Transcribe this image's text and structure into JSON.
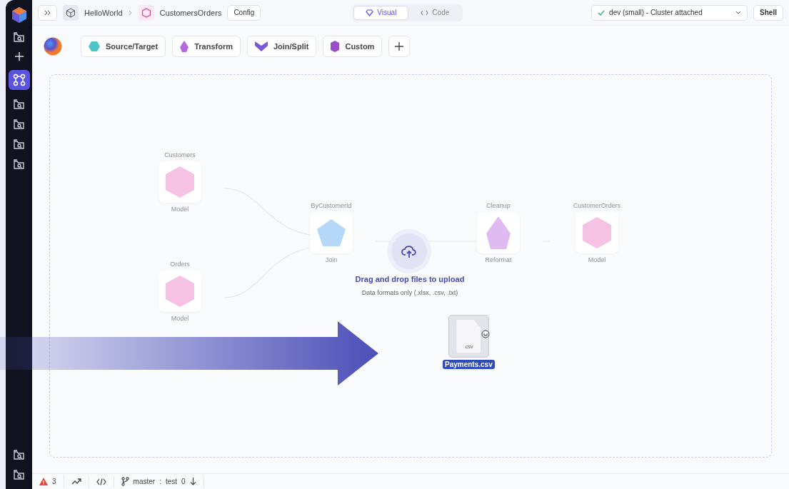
{
  "top_bar": {
    "breadcrumb": [
      {
        "label": "HelloWorld",
        "kind": "project"
      },
      {
        "label": "CustomersOrders",
        "kind": "pipeline"
      }
    ],
    "config_button": "Config",
    "view_tabs": [
      {
        "label": "Visual",
        "kind": "visual",
        "selected": true
      },
      {
        "label": "Code",
        "kind": "code",
        "selected": false
      }
    ],
    "cluster": {
      "label": "dev (small) - Cluster attached",
      "attached": true
    },
    "shell_button": "Shell"
  },
  "palette": [
    {
      "label": "Source/Target",
      "kind": "source"
    },
    {
      "label": "Transform",
      "kind": "transform"
    },
    {
      "label": "Join/Split",
      "kind": "join"
    },
    {
      "label": "Custom",
      "kind": "custom"
    }
  ],
  "canvas": {
    "nodes": [
      {
        "title": "Customers",
        "subtitle": "Model",
        "kind": "model"
      },
      {
        "title": "Orders",
        "subtitle": "Model",
        "kind": "model"
      },
      {
        "title": "ByCustomerId",
        "subtitle": "Join",
        "kind": "join"
      },
      {
        "title": "Cleanup",
        "subtitle": "Reformat",
        "kind": "transform"
      },
      {
        "title": "CustomerOrders",
        "subtitle": "Model",
        "kind": "model"
      }
    ],
    "upload": {
      "title": "Drag and drop files to upload",
      "hint": "Data formats only (.xlsx, .csv, .txt)"
    },
    "dragged_file": {
      "name": "Payments.csv",
      "extension": ".csv"
    }
  },
  "status_bar": {
    "errors": "3",
    "branch": "master",
    "separator": ":",
    "target": "test",
    "count": "0"
  }
}
